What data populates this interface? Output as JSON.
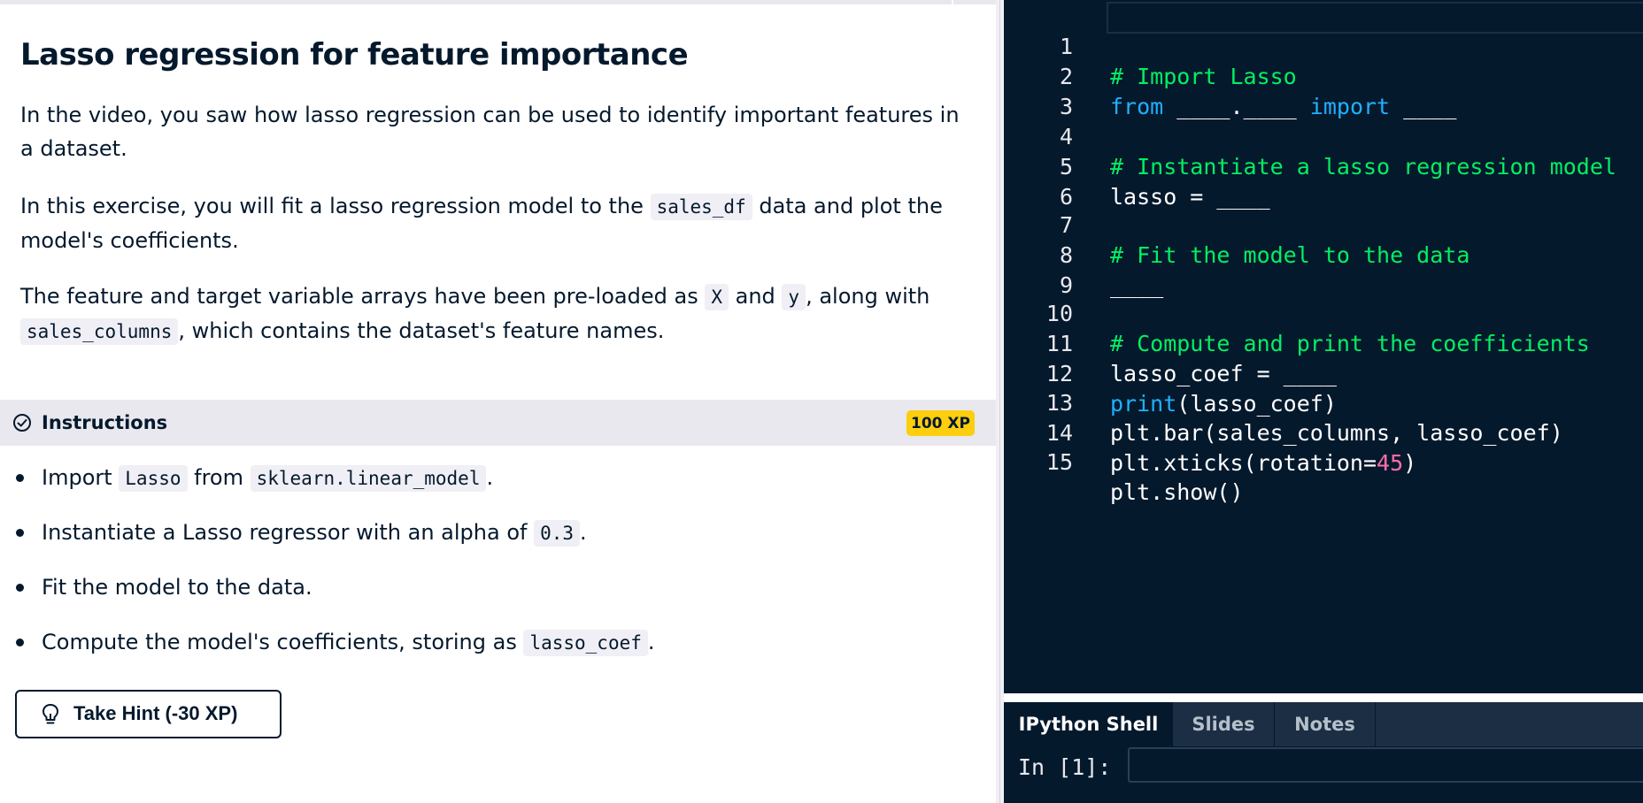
{
  "exercise": {
    "title": "Lasso regression for feature importance",
    "p1": "In the video, you saw how lasso regression can be used to identify important features in a dataset.",
    "p2_a": "In this exercise, you will fit a lasso regression model to the ",
    "p2_code": "sales_df",
    "p2_b": " data and plot the model's coefficients.",
    "p3_a": "The feature and target variable arrays have been pre-loaded as ",
    "p3_code1": "X",
    "p3_b": " and ",
    "p3_code2": "y",
    "p3_c": ", along with ",
    "p3_code3": "sales_columns",
    "p3_d": ", which contains the dataset's feature names."
  },
  "instructions": {
    "label": "Instructions",
    "xp": "100 XP",
    "items": [
      {
        "a": "Import ",
        "code1": "Lasso",
        "b": " from ",
        "code2": "sklearn.linear_model",
        "c": "."
      },
      {
        "a": "Instantiate a Lasso regressor with an alpha of ",
        "code1": "0.3",
        "b": "."
      },
      {
        "a": "Fit the model to the data."
      },
      {
        "a": "Compute the model's coefficients, storing as ",
        "code1": "lasso_coef",
        "b": "."
      }
    ],
    "hint_button": "Take Hint (-30 XP)"
  },
  "editor": {
    "line_numbers": [
      "1",
      "2",
      "3",
      "4",
      "5",
      "6",
      "7",
      "8",
      "9",
      "10",
      "11",
      "12",
      "13",
      "14",
      "15"
    ],
    "l1": "# Import Lasso",
    "l2_kw1": "from",
    "l2_a": " ____.____ ",
    "l2_kw2": "import",
    "l2_b": " ____",
    "l4": "# Instantiate a lasso regression model",
    "l5": "lasso = ____",
    "l7": "# Fit the model to the data",
    "l8": "____",
    "l10": "# Compute and print the coefficients",
    "l11": "lasso_coef = ____",
    "l12_kw": "print",
    "l12_b": "(lasso_coef)",
    "l13": "plt.bar(sales_columns, lasso_coef)",
    "l14_a": "plt.xticks(rotation=",
    "l14_num": "45",
    "l14_b": ")",
    "l15": "plt.show()"
  },
  "console": {
    "tabs": [
      "IPython Shell",
      "Slides",
      "Notes"
    ],
    "prompt": "In [1]:",
    "input_value": ""
  },
  "colors": {
    "navy": "#05192d",
    "comment_green": "#03ef62",
    "keyword_blue": "#1fb1ff",
    "number_pink": "#ff6ea9",
    "xp_yellow": "#fcce0d"
  }
}
